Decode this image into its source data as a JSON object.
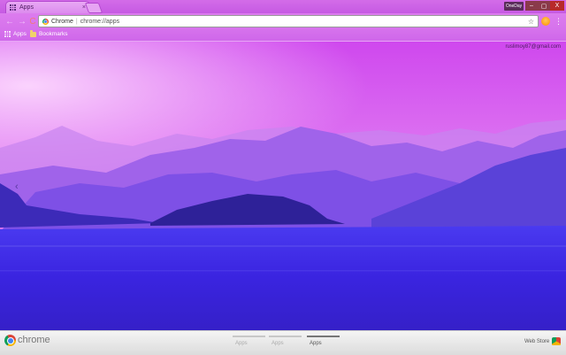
{
  "tab": {
    "title": "Apps",
    "close_glyph": "×"
  },
  "window": {
    "user_label": "OneDay",
    "minimize": "–",
    "maximize": "▢",
    "close": "X"
  },
  "toolbar": {
    "back_glyph": "←",
    "forward_glyph": "→",
    "reload_glyph": "C",
    "omnibox_chip": "Chrome",
    "omnibox_separator": "|",
    "omnibox_url": "chrome://apps",
    "star_glyph": "☆",
    "menu_glyph": "⋮"
  },
  "bookmarks": [
    {
      "label": "Apps",
      "icon": "apps-grid-icon"
    },
    {
      "label": "Bookmarks",
      "icon": "folder-icon"
    }
  ],
  "account": {
    "email": "ruslimoy87@gmail.com"
  },
  "wallpaper": {
    "nav_arrow": "‹"
  },
  "bottom_bar": {
    "brand": "chrome",
    "page_tabs": [
      {
        "label": "Apps",
        "active": false
      },
      {
        "label": "Apps",
        "active": false
      },
      {
        "label": "Apps",
        "active": true
      }
    ],
    "webstore_label": "Web Store"
  },
  "colors": {
    "accent": "#d672ec",
    "sky_top": "#d24cf0",
    "water": "#3a2ad8"
  }
}
